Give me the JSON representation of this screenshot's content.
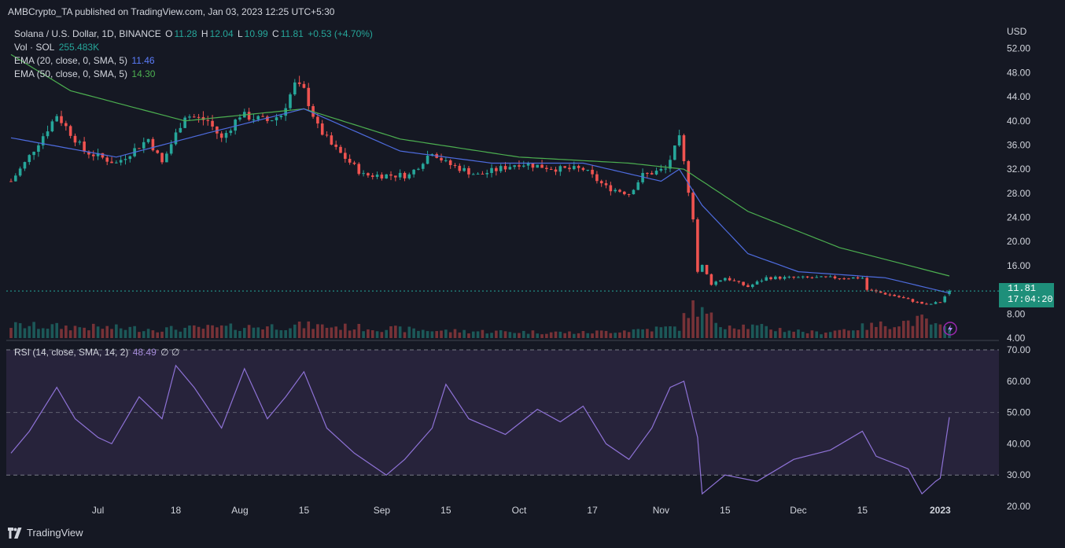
{
  "header": {
    "publish_line": "AMBCrypto_TA published on TradingView.com, Jan 03, 2023 12:25 UTC+5:30"
  },
  "legend": {
    "symbol": "Solana / U.S. Dollar, 1D, BINANCE",
    "o_label": "O",
    "o_value": "11.28",
    "h_label": "H",
    "h_value": "12.04",
    "l_label": "L",
    "l_value": "10.99",
    "c_label": "C",
    "c_value": "11.81",
    "change": "+0.53 (+4.70%)",
    "vol_label": "Vol · SOL",
    "vol_value": "255.483K",
    "ema20_label": "EMA (20, close, 0, SMA, 5)",
    "ema20_value": "11.46",
    "ema50_label": "EMA (50, close, 0, SMA, 5)",
    "ema50_value": "14.30",
    "rsi_label": "RSI (14, close, SMA, 14, 2)",
    "rsi_value": "48.49",
    "rsi_extra": "∅ ∅"
  },
  "price_tag": {
    "price": "11.81",
    "countdown": "17:04:20"
  },
  "footer": {
    "brand": "TradingView"
  },
  "colors": {
    "background": "#151823",
    "up": "#26a69a",
    "down": "#ef5350",
    "ema20": "#4e6cdf",
    "ema50": "#4caf50",
    "rsi": "#8e72d6",
    "rsi_band": "#7e57c2"
  },
  "chart_data": [
    {
      "type": "candlestick",
      "title": "Solana / U.S. Dollar, 1D, BINANCE",
      "ylabel": "USD",
      "ylim": [
        4,
        56
      ],
      "yticks": [
        "52.00",
        "48.00",
        "44.00",
        "40.00",
        "36.00",
        "32.00",
        "28.00",
        "24.00",
        "20.00",
        "16.00",
        "12.00",
        "8.00",
        "4.00"
      ],
      "xticks": [
        "Jul",
        "18",
        "Aug",
        "15",
        "Sep",
        "15",
        "Oct",
        "17",
        "Nov",
        "15",
        "Dec",
        "15",
        "2023"
      ],
      "x_range": [
        "2022-06-12",
        "2023-01-03"
      ],
      "close_keypoints": [
        [
          "2022-06-12",
          30
        ],
        [
          "2022-06-15",
          33
        ],
        [
          "2022-06-22",
          41
        ],
        [
          "2022-06-28",
          35
        ],
        [
          "2022-07-05",
          33
        ],
        [
          "2022-07-12",
          37
        ],
        [
          "2022-07-15",
          33
        ],
        [
          "2022-07-20",
          41
        ],
        [
          "2022-07-25",
          40
        ],
        [
          "2022-07-28",
          37
        ],
        [
          "2022-08-01",
          41
        ],
        [
          "2022-08-07",
          40
        ],
        [
          "2022-08-10",
          41
        ],
        [
          "2022-08-13",
          46
        ],
        [
          "2022-08-15",
          45
        ],
        [
          "2022-08-18",
          39
        ],
        [
          "2022-08-21",
          36
        ],
        [
          "2022-08-28",
          31
        ],
        [
          "2022-09-02",
          31
        ],
        [
          "2022-09-07",
          31
        ],
        [
          "2022-09-12",
          35
        ],
        [
          "2022-09-15",
          33
        ],
        [
          "2022-09-22",
          31
        ],
        [
          "2022-10-01",
          33
        ],
        [
          "2022-10-10",
          32
        ],
        [
          "2022-10-15",
          32
        ],
        [
          "2022-10-20",
          29
        ],
        [
          "2022-10-25",
          28
        ],
        [
          "2022-10-28",
          31
        ],
        [
          "2022-11-02",
          32
        ],
        [
          "2022-11-05",
          37
        ],
        [
          "2022-11-06",
          33
        ],
        [
          "2022-11-08",
          24
        ],
        [
          "2022-11-09",
          15
        ],
        [
          "2022-11-10",
          16
        ],
        [
          "2022-11-12",
          13
        ],
        [
          "2022-11-15",
          14
        ],
        [
          "2022-11-20",
          12.5
        ],
        [
          "2022-11-24",
          14
        ],
        [
          "2022-12-05",
          14
        ],
        [
          "2022-12-15",
          14
        ],
        [
          "2022-12-16",
          12
        ],
        [
          "2022-12-22",
          11
        ],
        [
          "2022-12-29",
          9.5
        ],
        [
          "2023-01-01",
          10
        ],
        [
          "2023-01-03",
          11.81
        ]
      ],
      "ema20_keypoints": [
        [
          "2022-06-12",
          37.2
        ],
        [
          "2022-07-05",
          34
        ],
        [
          "2022-07-25",
          38
        ],
        [
          "2022-08-15",
          42
        ],
        [
          "2022-09-05",
          35
        ],
        [
          "2022-09-25",
          33
        ],
        [
          "2022-10-15",
          33
        ],
        [
          "2022-11-01",
          30
        ],
        [
          "2022-11-05",
          32
        ],
        [
          "2022-11-10",
          26
        ],
        [
          "2022-11-20",
          18
        ],
        [
          "2022-12-01",
          15
        ],
        [
          "2022-12-20",
          14
        ],
        [
          "2023-01-03",
          11.46
        ]
      ],
      "ema50_keypoints": [
        [
          "2022-06-12",
          51
        ],
        [
          "2022-06-25",
          45
        ],
        [
          "2022-07-20",
          40
        ],
        [
          "2022-08-15",
          42
        ],
        [
          "2022-09-05",
          37
        ],
        [
          "2022-10-01",
          34
        ],
        [
          "2022-10-25",
          33
        ],
        [
          "2022-11-06",
          32
        ],
        [
          "2022-11-20",
          25
        ],
        [
          "2022-12-10",
          19
        ],
        [
          "2023-01-03",
          14.3
        ]
      ],
      "last_price": 11.81,
      "last_ohlc": {
        "open": 11.28,
        "high": 12.04,
        "low": 10.99,
        "close": 11.81
      }
    },
    {
      "type": "bar",
      "title": "Vol · SOL",
      "last_value": "255.483K",
      "volume_relative_keypoints": [
        [
          "2022-06-12",
          0.35
        ],
        [
          "2022-07-15",
          0.25
        ],
        [
          "2022-08-15",
          0.35
        ],
        [
          "2022-09-15",
          0.2
        ],
        [
          "2022-10-15",
          0.15
        ],
        [
          "2022-11-05",
          0.3
        ],
        [
          "2022-11-08",
          1.0
        ],
        [
          "2022-11-10",
          0.7
        ],
        [
          "2022-11-14",
          0.4
        ],
        [
          "2022-12-05",
          0.15
        ],
        [
          "2022-12-28",
          0.5
        ],
        [
          "2023-01-03",
          0.2
        ]
      ]
    },
    {
      "type": "line",
      "title": "RSI (14, close, SMA, 14, 2)",
      "ylim": [
        18,
        72
      ],
      "yticks": [
        "70.00",
        "60.00",
        "50.00",
        "40.00",
        "30.00",
        "20.00"
      ],
      "bands": [
        70,
        50,
        30
      ],
      "last_value": 48.49,
      "rsi_keypoints": [
        [
          "2022-06-12",
          37
        ],
        [
          "2022-06-16",
          44
        ],
        [
          "2022-06-22",
          58
        ],
        [
          "2022-06-26",
          48
        ],
        [
          "2022-07-01",
          42
        ],
        [
          "2022-07-04",
          40
        ],
        [
          "2022-07-10",
          55
        ],
        [
          "2022-07-15",
          48
        ],
        [
          "2022-07-18",
          65
        ],
        [
          "2022-07-22",
          58
        ],
        [
          "2022-07-28",
          45
        ],
        [
          "2022-08-02",
          64
        ],
        [
          "2022-08-07",
          48
        ],
        [
          "2022-08-11",
          55
        ],
        [
          "2022-08-15",
          63
        ],
        [
          "2022-08-20",
          45
        ],
        [
          "2022-08-26",
          37
        ],
        [
          "2022-09-02",
          30
        ],
        [
          "2022-09-06",
          35
        ],
        [
          "2022-09-12",
          45
        ],
        [
          "2022-09-15",
          59
        ],
        [
          "2022-09-20",
          48
        ],
        [
          "2022-09-28",
          43
        ],
        [
          "2022-10-05",
          51
        ],
        [
          "2022-10-10",
          47
        ],
        [
          "2022-10-15",
          52
        ],
        [
          "2022-10-20",
          40
        ],
        [
          "2022-10-25",
          35
        ],
        [
          "2022-10-30",
          45
        ],
        [
          "2022-11-03",
          58
        ],
        [
          "2022-11-06",
          60
        ],
        [
          "2022-11-09",
          42
        ],
        [
          "2022-11-10",
          24
        ],
        [
          "2022-11-15",
          30
        ],
        [
          "2022-11-22",
          28
        ],
        [
          "2022-11-30",
          35
        ],
        [
          "2022-12-08",
          38
        ],
        [
          "2022-12-15",
          44
        ],
        [
          "2022-12-18",
          36
        ],
        [
          "2022-12-25",
          32
        ],
        [
          "2022-12-28",
          24
        ],
        [
          "2022-12-31",
          28
        ],
        [
          "2023-01-01",
          29
        ],
        [
          "2023-01-03",
          48.49
        ]
      ]
    }
  ]
}
